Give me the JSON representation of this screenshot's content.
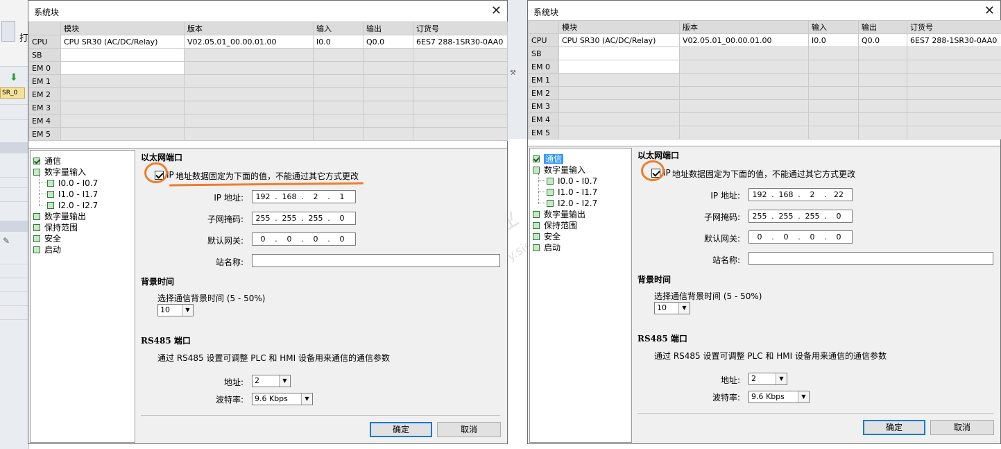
{
  "dialogs": [
    {
      "title": "系统块",
      "headers": [
        "",
        "模块",
        "版本",
        "输入",
        "输出",
        "订货号"
      ],
      "rows": [
        {
          "slot": "CPU",
          "module": "CPU SR30 (AC/DC/Relay)",
          "version": "V02.05.01_00.00.01.00",
          "input": "I0.0",
          "output": "Q0.0",
          "order": "6ES7 288-1SR30-0AA0"
        },
        {
          "slot": "SB",
          "module": "",
          "version": "",
          "input": "",
          "output": "",
          "order": ""
        },
        {
          "slot": "EM 0",
          "module": "",
          "version": "",
          "input": "",
          "output": "",
          "order": ""
        },
        {
          "slot": "EM 1",
          "module": "",
          "version": "",
          "input": "",
          "output": "",
          "order": ""
        },
        {
          "slot": "EM 2",
          "module": "",
          "version": "",
          "input": "",
          "output": "",
          "order": ""
        },
        {
          "slot": "EM 3",
          "module": "",
          "version": "",
          "input": "",
          "output": "",
          "order": ""
        },
        {
          "slot": "EM 4",
          "module": "",
          "version": "",
          "input": "",
          "output": "",
          "order": ""
        },
        {
          "slot": "EM 5",
          "module": "",
          "version": "",
          "input": "",
          "output": "",
          "order": ""
        }
      ],
      "tree": [
        "通信",
        "数字量输入",
        "I0.0 - I0.7",
        "I1.0 - I1.7",
        "I2.0 - I2.7",
        "数字量输出",
        "保持范围",
        "安全",
        "启动"
      ],
      "ethernet_title": "以太网端口",
      "ip_fixed_label_prefix": "IP",
      "ip_fixed_label_rest": "地址数据固定为下面的值，不能通过其它方式更改",
      "ip_label": "IP 地址:",
      "ip": [
        "192",
        "168",
        "2",
        "1"
      ],
      "mask_label": "子网掩码:",
      "mask": [
        "255",
        "255",
        "255",
        "0"
      ],
      "gateway_label": "默认网关:",
      "gateway": [
        "0",
        "0",
        "0",
        "0"
      ],
      "station_label": "站名称:",
      "station": "",
      "bg_title": "背景时间",
      "bg_desc": "选择通信背景时间 (5 - 50%)",
      "bg_value": "10",
      "rs485_title": "RS485 端口",
      "rs485_desc": "通过 RS485 设置可调整 PLC 和 HMI 设备用来通信的通信参数",
      "addr_label": "地址:",
      "addr_value": "2",
      "baud_label": "波特率:",
      "baud_value": "9.6 Kbps",
      "ok_label": "确定",
      "cancel_label": "取消"
    },
    {
      "title": "系统块",
      "headers": [
        "",
        "模块",
        "版本",
        "输入",
        "输出",
        "订货号"
      ],
      "rows": [
        {
          "slot": "CPU",
          "module": "CPU SR30 (AC/DC/Relay)",
          "version": "V02.05.01_00.00.01.00",
          "input": "I0.0",
          "output": "Q0.0",
          "order": "6ES7 288-1SR30-0AA0"
        },
        {
          "slot": "SB",
          "module": "",
          "version": "",
          "input": "",
          "output": "",
          "order": ""
        },
        {
          "slot": "EM 0",
          "module": "",
          "version": "",
          "input": "",
          "output": "",
          "order": ""
        },
        {
          "slot": "EM 1",
          "module": "",
          "version": "",
          "input": "",
          "output": "",
          "order": ""
        },
        {
          "slot": "EM 2",
          "module": "",
          "version": "",
          "input": "",
          "output": "",
          "order": ""
        },
        {
          "slot": "EM 3",
          "module": "",
          "version": "",
          "input": "",
          "output": "",
          "order": ""
        },
        {
          "slot": "EM 4",
          "module": "",
          "version": "",
          "input": "",
          "output": "",
          "order": ""
        },
        {
          "slot": "EM 5",
          "module": "",
          "version": "",
          "input": "",
          "output": "",
          "order": ""
        }
      ],
      "tree": [
        "通信",
        "数字量输入",
        "I0.0 - I0.7",
        "I1.0 - I1.7",
        "I2.0 - I2.7",
        "数字量输出",
        "保持范围",
        "安全",
        "启动"
      ],
      "ethernet_title": "以太网端口",
      "ip_fixed_label_prefix": "IP",
      "ip_fixed_label_rest": "地址数据固定为下面的值，不能通过其它方式更改",
      "ip_label": "IP 地址:",
      "ip": [
        "192",
        "168",
        "2",
        "22"
      ],
      "mask_label": "子网掩码:",
      "mask": [
        "255",
        "255",
        "255",
        "0"
      ],
      "gateway_label": "默认网关:",
      "gateway": [
        "0",
        "0",
        "0",
        "0"
      ],
      "station_label": "站名称:",
      "station": "",
      "bg_title": "背景时间",
      "bg_desc": "选择通信背景时间 (5 - 50%)",
      "bg_value": "10",
      "rs485_title": "RS485 端口",
      "rs485_desc": "通过 RS485 设置可调整 PLC 和 HMI 设备用来通信的通信参数",
      "addr_label": "地址:",
      "addr_value": "2",
      "baud_label": "波特率:",
      "baud_value": "9.6 Kbps",
      "ok_label": "确定",
      "cancel_label": "取消"
    }
  ],
  "background": {
    "toolbar_text": "打",
    "tab_label": "SR_0"
  },
  "watermark": {
    "line1": "西门子工业",
    "line2": "support.industry.siemens.com/cs"
  },
  "accent_orange": "#ef7d2a",
  "selection_blue": "#3399ff"
}
